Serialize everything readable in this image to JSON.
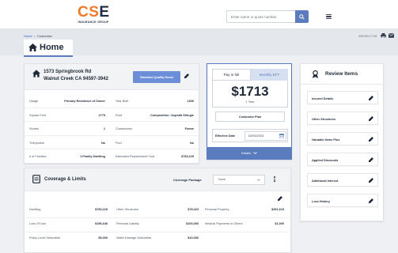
{
  "header": {
    "logo_letters": [
      "C",
      "S",
      "E"
    ],
    "logo_subtitle": "INSURANCE GROUP",
    "search_placeholder": "Enter name or quote number"
  },
  "breadcrumb": [
    "Home",
    "Customize"
  ],
  "quote_id": "AR00017745",
  "page_title": "Home",
  "property": {
    "address_line1": "1573 Springbrook Rd",
    "address_line2": "Walnut Creek CA 94597-3942",
    "quality_button": "Standard Quality Home",
    "details": [
      {
        "label": "Usage",
        "value": "Primary Residence of Owner",
        "label2": "Year Built",
        "value2": "1930"
      },
      {
        "label": "Square Feet",
        "value": "2779",
        "label2": "Roof",
        "value2": "Composition / Asphalt Shingle"
      },
      {
        "label": "Stories",
        "value": "1",
        "label2": "Construction",
        "value2": "Frame"
      },
      {
        "label": "Trampoline",
        "value": "No",
        "label2": "Pool",
        "value2": "No"
      },
      {
        "label": "# of Families",
        "value": "1 Family Dwelling",
        "label2": "Estimated Replacement Cost",
        "value2": "$783,229"
      }
    ]
  },
  "payment": {
    "tabs": [
      "Pay in full",
      "Monthly EFT"
    ],
    "active_tab": 0,
    "price": "$1713",
    "term": "1 Year",
    "customize_label": "Customize Plan",
    "effective_label": "Effective Date",
    "effective_value": "02/03/2023",
    "details_label": "Details"
  },
  "review": {
    "title": "Review Items",
    "items": [
      "Insured Details",
      "Other Structures",
      "Valuable Items Plus",
      "Applied Discounts",
      "Additional Interest",
      "Loss History"
    ]
  },
  "coverage": {
    "title": "Coverage & Limits",
    "package_label": "Coverage Package",
    "package_value": "None",
    "rows": [
      [
        {
          "label": "Dwelling",
          "value": "$783,229"
        },
        {
          "label": "Other Structures",
          "value": "$78,323"
        },
        {
          "label": "Personal Property",
          "value": "$391,615"
        }
      ],
      [
        {
          "label": "Loss Of Use",
          "value": "$156,646"
        },
        {
          "label": "Personal Liability",
          "value": "$100,000"
        },
        {
          "label": "Medical Payments to Others",
          "value": "$1,000"
        }
      ],
      [
        {
          "label": "Policy Level Deductible",
          "value": "$5,000"
        },
        {
          "label": "Water Damage Deductible",
          "value": "$10,000"
        }
      ]
    ]
  },
  "colors": {
    "accent": "#5b7bbf",
    "logo_orange": "#f07b2a",
    "logo_navy": "#1f2a44"
  }
}
